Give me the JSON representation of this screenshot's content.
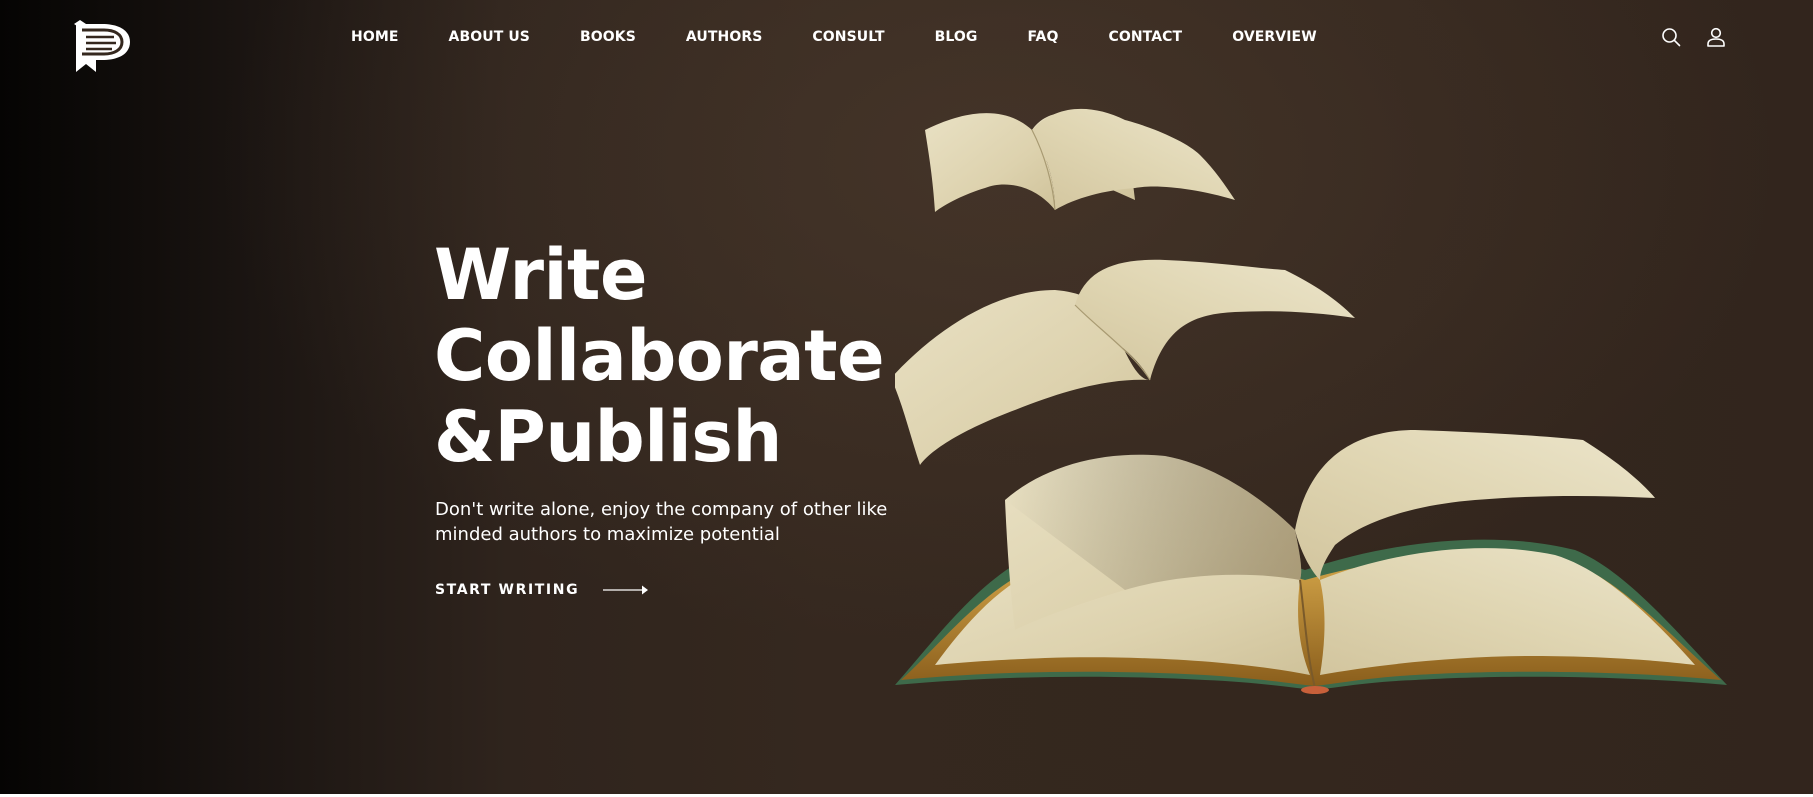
{
  "nav": {
    "items": [
      {
        "label": "HOME"
      },
      {
        "label": "ABOUT US"
      },
      {
        "label": "BOOKS"
      },
      {
        "label": "AUTHORS"
      },
      {
        "label": "CONSULT"
      },
      {
        "label": "BLOG"
      },
      {
        "label": "FAQ"
      },
      {
        "label": "CONTACT"
      },
      {
        "label": "OVERVIEW"
      }
    ]
  },
  "header": {
    "logo_icon": "bookmark-p-logo",
    "icons": [
      "search-icon",
      "user-icon"
    ]
  },
  "hero": {
    "headline": [
      "Write",
      "Collaborate",
      "&Publish"
    ],
    "subtext": "Don't write alone, enjoy the company of other like minded authors to maximize potential",
    "cta_label": "START WRITING",
    "cta_icon": "arrow-right-icon",
    "illustration": "open-books-with-flying-pages-image"
  },
  "colors": {
    "background": "#34271e",
    "background_dark": "#050403",
    "text": "#ffffff",
    "paper": "#e4dbbd",
    "book_cover": "#3e6a4a",
    "page_edge": "#b8862e"
  }
}
